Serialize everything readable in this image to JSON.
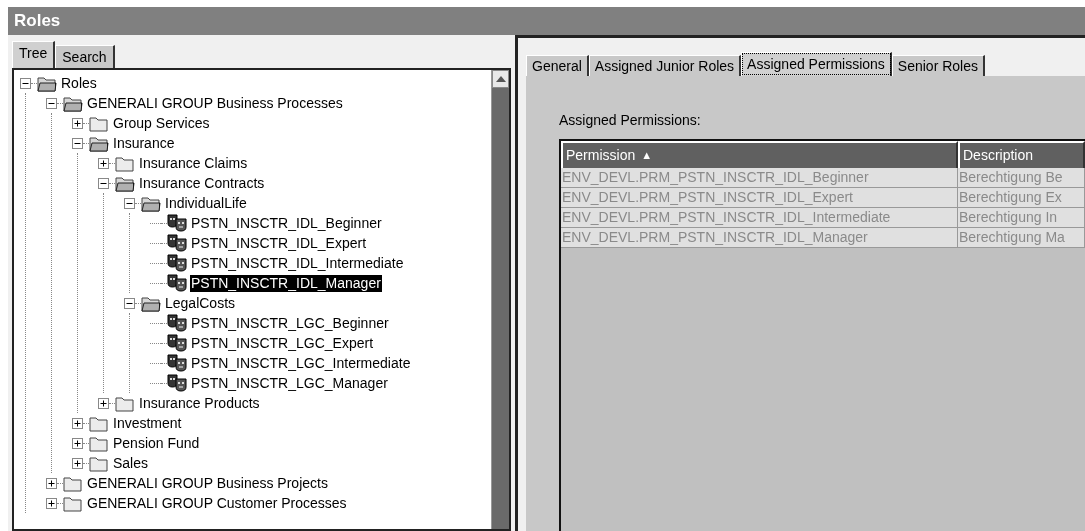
{
  "window": {
    "title": "Roles"
  },
  "left_tabs": [
    {
      "label": "Tree",
      "selected": true
    },
    {
      "label": "Search",
      "selected": false
    }
  ],
  "tree": [
    {
      "kind": "folder",
      "label": "Roles",
      "expanded": true,
      "selected": false,
      "children": [
        {
          "kind": "folder",
          "label": "GENERALI GROUP Business Processes",
          "expanded": true,
          "selected": false,
          "children": [
            {
              "kind": "folder",
              "label": "Group Services",
              "expanded": false,
              "selected": false
            },
            {
              "kind": "folder",
              "label": "Insurance",
              "expanded": true,
              "selected": false,
              "children": [
                {
                  "kind": "folder",
                  "label": "Insurance Claims",
                  "expanded": false,
                  "selected": false
                },
                {
                  "kind": "folder",
                  "label": "Insurance Contracts",
                  "expanded": true,
                  "selected": false,
                  "children": [
                    {
                      "kind": "folder",
                      "label": "IndividualLife",
                      "expanded": true,
                      "selected": false,
                      "children": [
                        {
                          "kind": "role",
                          "label": "PSTN_INSCTR_IDL_Beginner",
                          "selected": false
                        },
                        {
                          "kind": "role",
                          "label": "PSTN_INSCTR_IDL_Expert",
                          "selected": false
                        },
                        {
                          "kind": "role",
                          "label": "PSTN_INSCTR_IDL_Intermediate",
                          "selected": false
                        },
                        {
                          "kind": "role",
                          "label": "PSTN_INSCTR_IDL_Manager",
                          "selected": true
                        }
                      ]
                    },
                    {
                      "kind": "folder",
                      "label": "LegalCosts",
                      "expanded": true,
                      "selected": false,
                      "children": [
                        {
                          "kind": "role",
                          "label": "PSTN_INSCTR_LGC_Beginner",
                          "selected": false
                        },
                        {
                          "kind": "role",
                          "label": "PSTN_INSCTR_LGC_Expert",
                          "selected": false
                        },
                        {
                          "kind": "role",
                          "label": "PSTN_INSCTR_LGC_Intermediate",
                          "selected": false
                        },
                        {
                          "kind": "role",
                          "label": "PSTN_INSCTR_LGC_Manager",
                          "selected": false
                        }
                      ]
                    }
                  ]
                },
                {
                  "kind": "folder",
                  "label": "Insurance Products",
                  "expanded": false,
                  "selected": false
                }
              ]
            },
            {
              "kind": "folder",
              "label": "Investment",
              "expanded": false,
              "selected": false
            },
            {
              "kind": "folder",
              "label": "Pension Fund",
              "expanded": false,
              "selected": false
            },
            {
              "kind": "folder",
              "label": "Sales",
              "expanded": false,
              "selected": false
            }
          ]
        },
        {
          "kind": "folder",
          "label": "GENERALI GROUP Business Projects",
          "expanded": false,
          "selected": false
        },
        {
          "kind": "folder",
          "label": "GENERALI GROUP Customer Processes",
          "expanded": false,
          "selected": false
        }
      ]
    }
  ],
  "right_tabs": [
    {
      "label": "General",
      "selected": false
    },
    {
      "label": "Assigned Junior Roles",
      "selected": false
    },
    {
      "label": "Assigned Permissions",
      "selected": true
    },
    {
      "label": "Senior Roles",
      "selected": false
    }
  ],
  "permissions": {
    "label": "Assigned Permissions:",
    "columns": [
      {
        "label": "Permission",
        "sort_icon": "▲"
      },
      {
        "label": "Description"
      }
    ],
    "rows": [
      [
        "ENV_DEVL.PRM_PSTN_INSCTR_IDL_Beginner",
        "Berechtigung Be"
      ],
      [
        "ENV_DEVL.PRM_PSTN_INSCTR_IDL_Expert",
        "Berechtigung Ex"
      ],
      [
        "ENV_DEVL.PRM_PSTN_INSCTR_IDL_Intermediate",
        "Berechtigung In"
      ],
      [
        "ENV_DEVL.PRM_PSTN_INSCTR_IDL_Manager",
        "Berechtigung Ma"
      ]
    ]
  }
}
